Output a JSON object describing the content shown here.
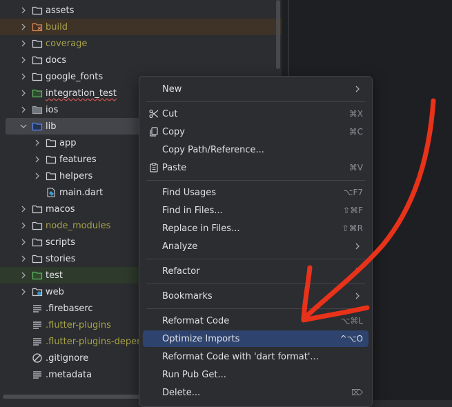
{
  "tree": [
    {
      "label": "assets",
      "type": "folder",
      "chevron": "right"
    },
    {
      "label": "build",
      "type": "folder-excluded",
      "chevron": "right",
      "color": "ignored",
      "highlight": "build"
    },
    {
      "label": "coverage",
      "type": "folder",
      "chevron": "right",
      "color": "ignored"
    },
    {
      "label": "docs",
      "type": "folder",
      "chevron": "right"
    },
    {
      "label": "google_fonts",
      "type": "folder",
      "chevron": "right"
    },
    {
      "label": "integration_test",
      "type": "folder-test",
      "chevron": "right",
      "error": true
    },
    {
      "label": "ios",
      "type": "folder-gray",
      "chevron": "right"
    },
    {
      "label": "lib",
      "type": "folder-source",
      "chevron": "down",
      "selected": true
    },
    {
      "label": "app",
      "type": "folder",
      "chevron": "right",
      "indent": 1
    },
    {
      "label": "features",
      "type": "folder",
      "chevron": "right",
      "indent": 1
    },
    {
      "label": "helpers",
      "type": "folder",
      "chevron": "right",
      "indent": 1
    },
    {
      "label": "main.dart",
      "type": "dart-file",
      "indent": 1
    },
    {
      "label": "macos",
      "type": "folder",
      "chevron": "right"
    },
    {
      "label": "node_modules",
      "type": "folder",
      "chevron": "right",
      "color": "ignored"
    },
    {
      "label": "scripts",
      "type": "folder",
      "chevron": "right"
    },
    {
      "label": "stories",
      "type": "folder",
      "chevron": "right"
    },
    {
      "label": "test",
      "type": "folder-test",
      "chevron": "right",
      "highlight": "test"
    },
    {
      "label": "web",
      "type": "folder-web",
      "chevron": "right"
    },
    {
      "label": ".firebaserc",
      "type": "text-file"
    },
    {
      "label": ".flutter-plugins",
      "type": "text-file",
      "color": "ignored"
    },
    {
      "label": ".flutter-plugins-deper",
      "type": "text-file",
      "color": "ignored"
    },
    {
      "label": ".gitignore",
      "type": "ignore-file"
    },
    {
      "label": ".metadata",
      "type": "text-file"
    }
  ],
  "menu": [
    {
      "label": "New",
      "submenu": true
    },
    {
      "sep": true
    },
    {
      "label": "Cut",
      "shortcut": "⌘X",
      "icon": "scissors-icon"
    },
    {
      "label": "Copy",
      "shortcut": "⌘C",
      "icon": "copy-icon"
    },
    {
      "label": "Copy Path/Reference..."
    },
    {
      "label": "Paste",
      "shortcut": "⌘V",
      "icon": "paste-icon"
    },
    {
      "sep": true
    },
    {
      "label": "Find Usages",
      "shortcut": "⌥F7"
    },
    {
      "label": "Find in Files...",
      "shortcut": "⇧⌘F"
    },
    {
      "label": "Replace in Files...",
      "shortcut": "⇧⌘R"
    },
    {
      "label": "Analyze",
      "submenu": true
    },
    {
      "sep": true
    },
    {
      "label": "Refactor",
      "submenu": true
    },
    {
      "sep": true
    },
    {
      "label": "Bookmarks",
      "submenu": true
    },
    {
      "sep": true
    },
    {
      "label": "Reformat Code",
      "shortcut": "⌥⌘L"
    },
    {
      "label": "Optimize Imports",
      "shortcut": "^⌥O",
      "highlighted": true
    },
    {
      "label": "Reformat Code with 'dart format'..."
    },
    {
      "label": "Run Pub Get..."
    },
    {
      "label": "Delete...",
      "shortcut": "⌦"
    }
  ],
  "colors": {
    "accent_highlight": "#2e436e",
    "annotation": "#e8321a",
    "ignored_text": "#a8a24a"
  }
}
